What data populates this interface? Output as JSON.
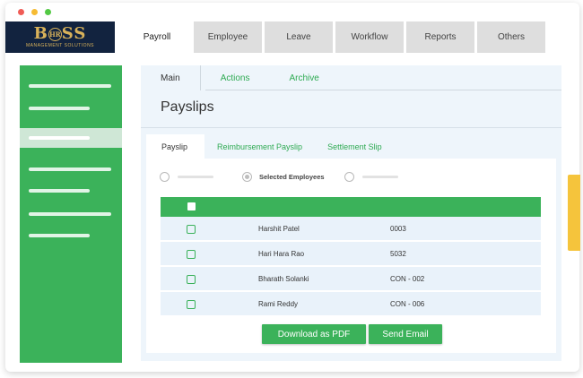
{
  "window": {
    "dot_colors": [
      "#f05c56",
      "#f6bb33",
      "#53c944"
    ]
  },
  "logo": {
    "brand_left": "B",
    "brand_hr": "HR",
    "brand_right": "SS",
    "tagline": "MANAGEMENT SOLUTIONS"
  },
  "topnav": {
    "tabs": [
      {
        "label": "Payroll",
        "active": true
      },
      {
        "label": "Employee",
        "active": false
      },
      {
        "label": "Leave",
        "active": false
      },
      {
        "label": "Workflow",
        "active": false
      },
      {
        "label": "Reports",
        "active": false
      },
      {
        "label": "Others",
        "active": false
      }
    ]
  },
  "sidebar": {
    "active_index": 3,
    "color": "#3bb25a"
  },
  "main": {
    "tabs": [
      {
        "label": "Main",
        "active": true
      },
      {
        "label": "Actions",
        "active": false
      },
      {
        "label": "Archive",
        "active": false
      }
    ],
    "title": "Payslips",
    "card_tabs": [
      {
        "label": "Payslip",
        "active": true
      },
      {
        "label": "Reimbursement Payslip",
        "active": false
      },
      {
        "label": "Settlement Slip",
        "active": false
      }
    ],
    "radio_options": {
      "selected_label": "Selected Employees"
    },
    "table": {
      "rows": [
        {
          "name": "Harshit Patel",
          "code": "0003"
        },
        {
          "name": "Hari Hara Rao",
          "code": "5032"
        },
        {
          "name": "Bharath Solanki",
          "code": "CON - 002"
        },
        {
          "name": "Rami Reddy",
          "code": "CON - 006"
        }
      ]
    },
    "buttons": {
      "download_pdf": "Download as PDF",
      "send_email": "Send Email"
    }
  },
  "accent_color": "#3bb25a",
  "scroll_tab_color": "#f5c43c"
}
